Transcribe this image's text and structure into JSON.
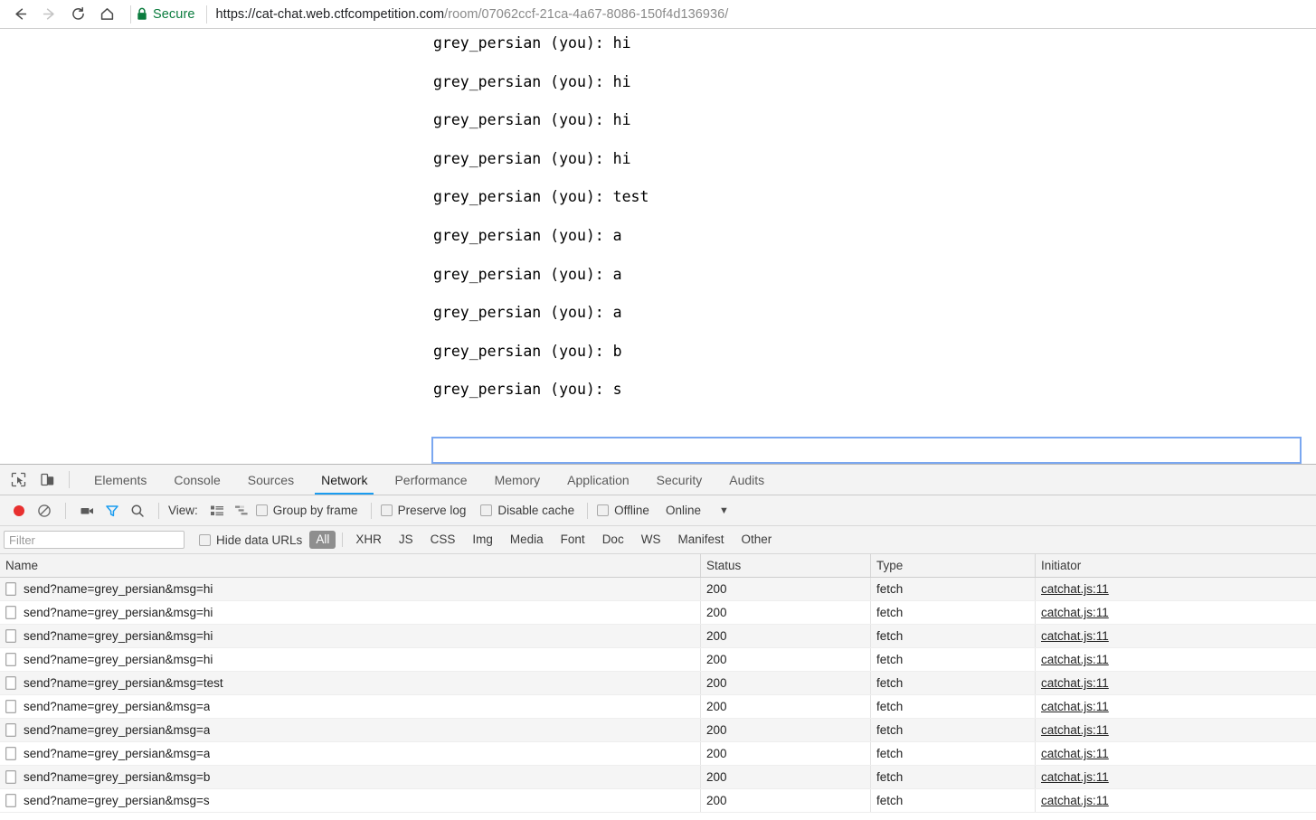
{
  "browser": {
    "back_label": "Back",
    "forward_label": "Forward",
    "reload_label": "Reload",
    "home_label": "Home",
    "security_text": "Secure",
    "url_origin": "https://cat-chat.web.ctfcompetition.com",
    "url_path": "/room/07062ccf-21ca-4a67-8086-150f4d136936/",
    "secure_color": "#0b7c3e"
  },
  "chat": {
    "messages": [
      "grey_persian (you): hi",
      "grey_persian (you): hi",
      "grey_persian (you): hi",
      "grey_persian (you): hi",
      "grey_persian (you): test",
      "grey_persian (you): a",
      "grey_persian (you): a",
      "grey_persian (you): a",
      "grey_persian (you): b",
      "grey_persian (you): s"
    ],
    "input_value": "",
    "input_placeholder": "",
    "focus_border_color": "#7aa7f0"
  },
  "devtools": {
    "tabs": [
      {
        "label": "Elements",
        "active": false
      },
      {
        "label": "Console",
        "active": false
      },
      {
        "label": "Sources",
        "active": false
      },
      {
        "label": "Network",
        "active": true
      },
      {
        "label": "Performance",
        "active": false
      },
      {
        "label": "Memory",
        "active": false
      },
      {
        "label": "Application",
        "active": false
      },
      {
        "label": "Security",
        "active": false
      },
      {
        "label": "Audits",
        "active": false
      }
    ],
    "active_tab_color": "#1a9cf0",
    "toolbar": {
      "record_label": "Record",
      "record_color": "#e8302f",
      "clear_label": "Clear",
      "capture_screenshots_label": "Capture screenshots",
      "filter_toggle_label": "Filter",
      "filter_toggle_color": "#1a9cf0",
      "search_label": "Search",
      "view_label": "View:",
      "view_list_label": "List view",
      "view_waterfall_label": "Waterfall view",
      "group_by_frame_label": "Group by frame",
      "preserve_log_label": "Preserve log",
      "disable_cache_label": "Disable cache",
      "offline_label": "Offline",
      "throttling_value": "Online",
      "throttling_caret": "▼"
    },
    "filterbar": {
      "filter_placeholder": "Filter",
      "filter_value": "",
      "hide_data_urls_label": "Hide data URLs",
      "types": [
        {
          "label": "All",
          "selected": true
        },
        {
          "label": "XHR",
          "selected": false
        },
        {
          "label": "JS",
          "selected": false
        },
        {
          "label": "CSS",
          "selected": false
        },
        {
          "label": "Img",
          "selected": false
        },
        {
          "label": "Media",
          "selected": false
        },
        {
          "label": "Font",
          "selected": false
        },
        {
          "label": "Doc",
          "selected": false
        },
        {
          "label": "WS",
          "selected": false
        },
        {
          "label": "Manifest",
          "selected": false
        },
        {
          "label": "Other",
          "selected": false
        }
      ],
      "selected_pill_bg": "#8e8e8e"
    },
    "network_table": {
      "columns": [
        "Name",
        "Status",
        "Type",
        "Initiator"
      ],
      "rows": [
        {
          "name": "send?name=grey_persian&msg=hi",
          "status": "200",
          "type": "fetch",
          "initiator": "catchat.js:11"
        },
        {
          "name": "send?name=grey_persian&msg=hi",
          "status": "200",
          "type": "fetch",
          "initiator": "catchat.js:11"
        },
        {
          "name": "send?name=grey_persian&msg=hi",
          "status": "200",
          "type": "fetch",
          "initiator": "catchat.js:11"
        },
        {
          "name": "send?name=grey_persian&msg=hi",
          "status": "200",
          "type": "fetch",
          "initiator": "catchat.js:11"
        },
        {
          "name": "send?name=grey_persian&msg=test",
          "status": "200",
          "type": "fetch",
          "initiator": "catchat.js:11"
        },
        {
          "name": "send?name=grey_persian&msg=a",
          "status": "200",
          "type": "fetch",
          "initiator": "catchat.js:11"
        },
        {
          "name": "send?name=grey_persian&msg=a",
          "status": "200",
          "type": "fetch",
          "initiator": "catchat.js:11"
        },
        {
          "name": "send?name=grey_persian&msg=a",
          "status": "200",
          "type": "fetch",
          "initiator": "catchat.js:11"
        },
        {
          "name": "send?name=grey_persian&msg=b",
          "status": "200",
          "type": "fetch",
          "initiator": "catchat.js:11"
        },
        {
          "name": "send?name=grey_persian&msg=s",
          "status": "200",
          "type": "fetch",
          "initiator": "catchat.js:11"
        }
      ]
    }
  }
}
